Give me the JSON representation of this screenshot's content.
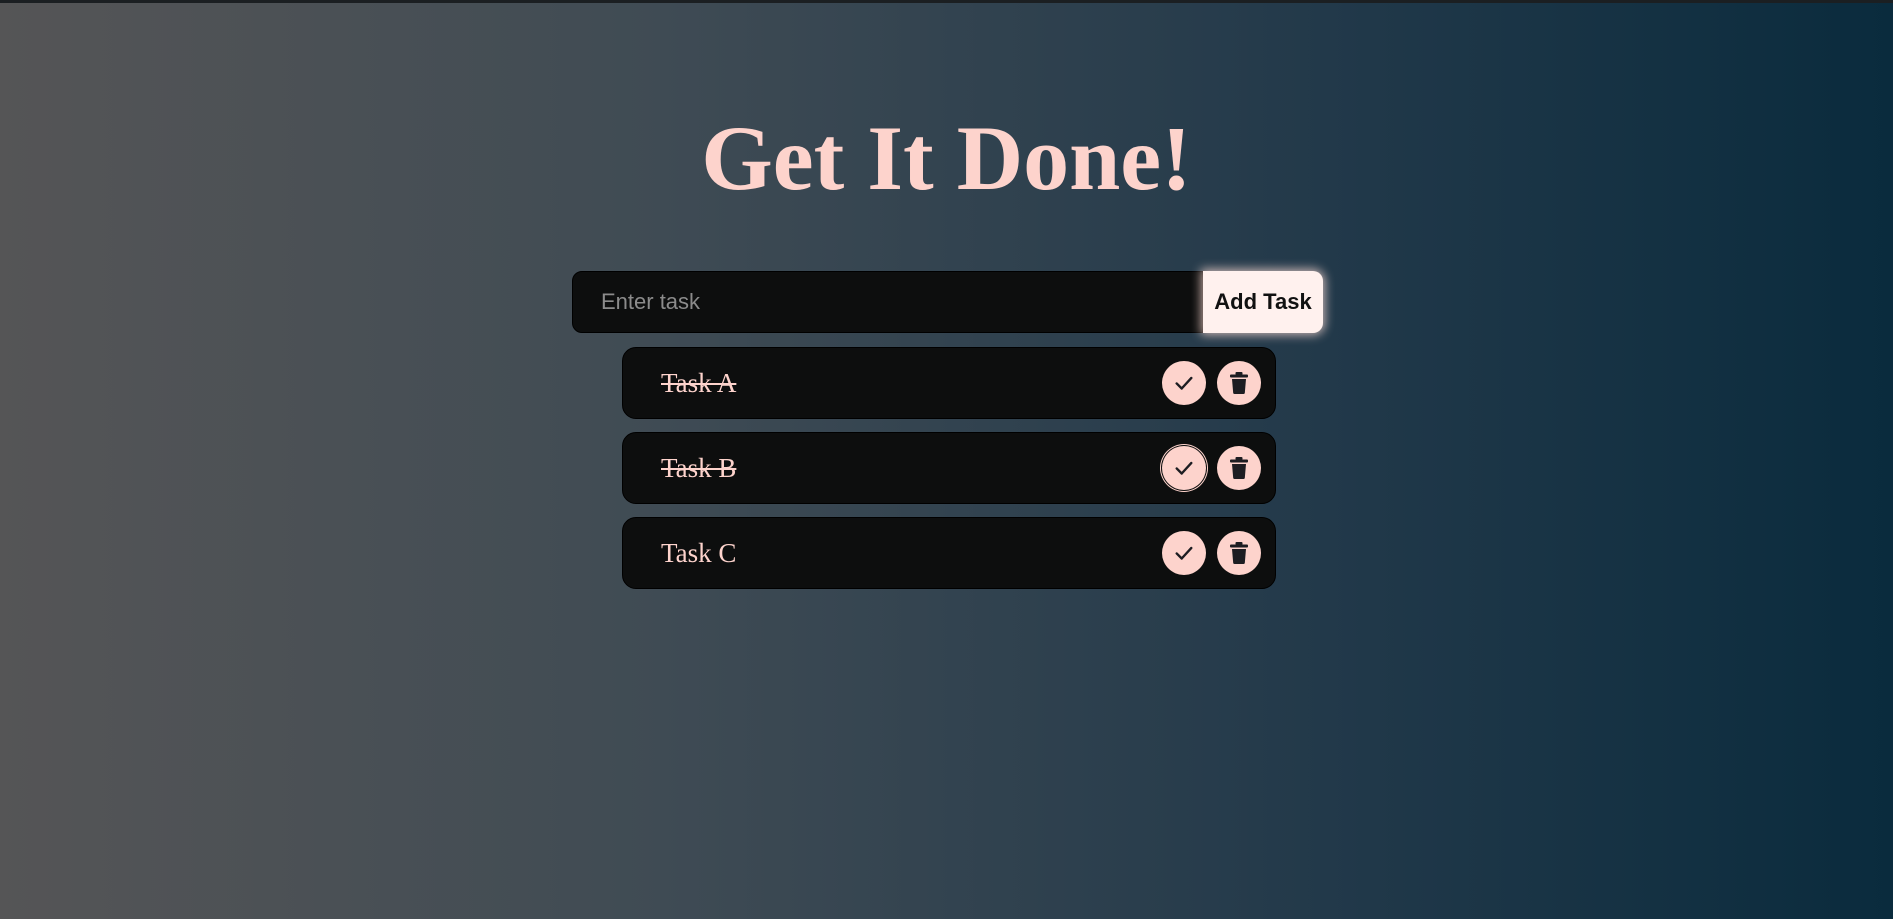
{
  "header": {
    "title": "Get It Done!"
  },
  "input": {
    "placeholder": "Enter task",
    "value": ""
  },
  "add_button": {
    "label": "Add Task"
  },
  "tasks": [
    {
      "label": "Task A",
      "completed": true
    },
    {
      "label": "Task B",
      "completed": true
    },
    {
      "label": "Task C",
      "completed": false
    }
  ],
  "icons": {
    "complete": "check-icon",
    "delete": "trash-icon"
  },
  "colors": {
    "accent": "#fdd3cc",
    "item_background": "#0d0e0e",
    "gradient_start": "#555556",
    "gradient_end": "#0a2b3d"
  }
}
